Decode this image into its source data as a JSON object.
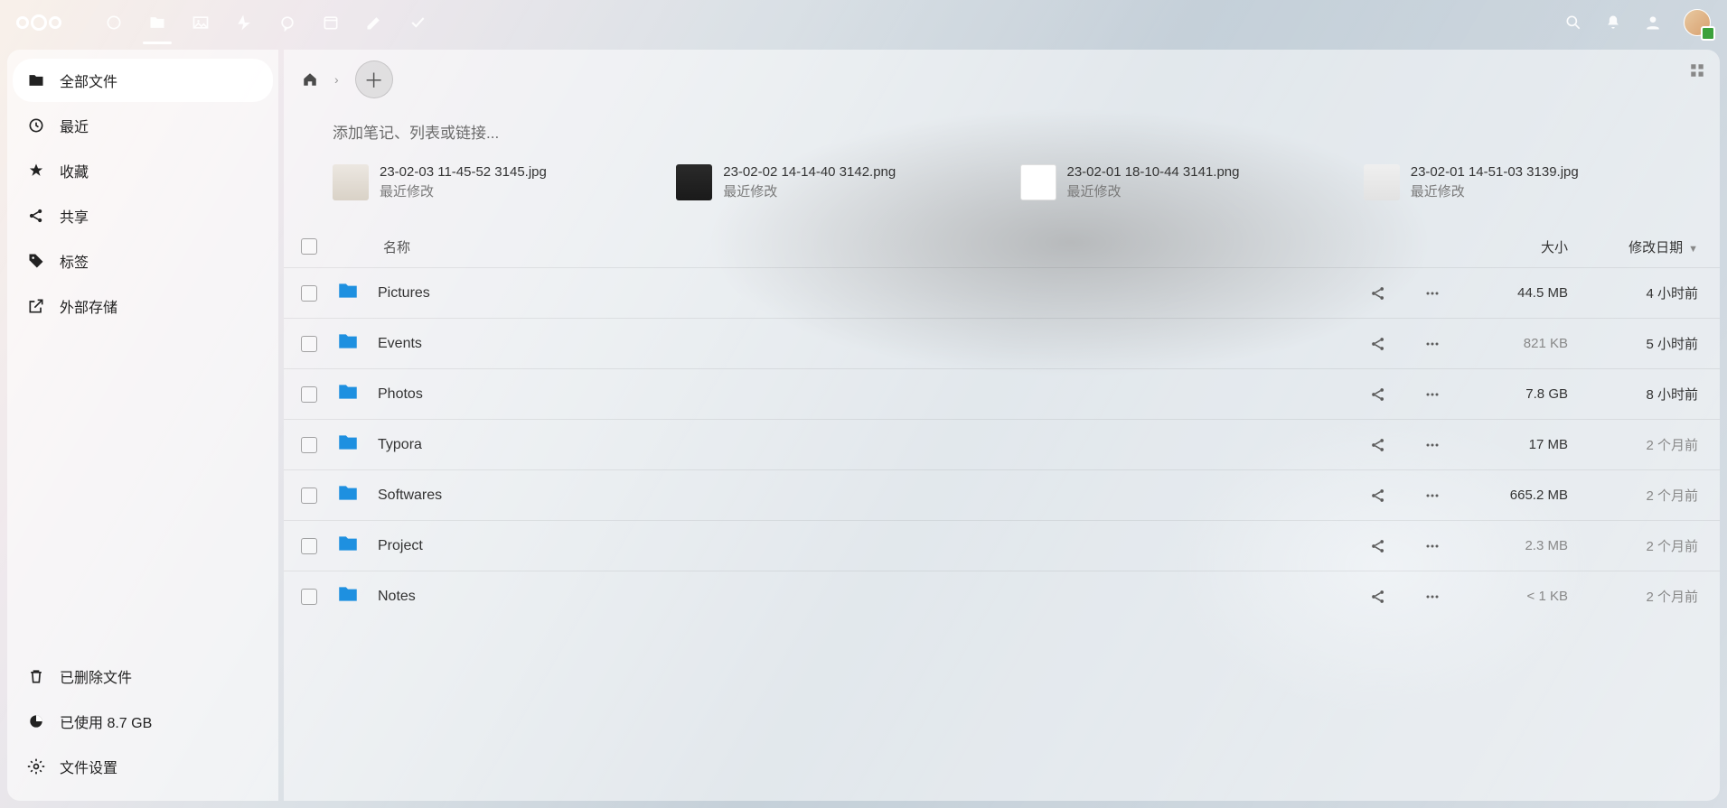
{
  "sidebar": {
    "items": [
      {
        "label": "全部文件"
      },
      {
        "label": "最近"
      },
      {
        "label": "收藏"
      },
      {
        "label": "共享"
      },
      {
        "label": "标签"
      },
      {
        "label": "外部存储"
      }
    ],
    "bottom": {
      "trash": "已删除文件",
      "quota": "已使用 8.7 GB",
      "settings": "文件设置"
    }
  },
  "notes_placeholder": "添加笔记、列表或链接...",
  "recent_label": "最近修改",
  "recent": [
    {
      "name": "23-02-03 11-45-52 3145.jpg"
    },
    {
      "name": "23-02-02 14-14-40 3142.png"
    },
    {
      "name": "23-02-01 18-10-44 3141.png"
    },
    {
      "name": "23-02-01 14-51-03 3139.jpg"
    }
  ],
  "columns": {
    "name": "名称",
    "size": "大小",
    "modified": "修改日期"
  },
  "files": [
    {
      "name": "Pictures",
      "size": "44.5 MB",
      "date": "4 小时前",
      "size_faded": false,
      "date_faded": false
    },
    {
      "name": "Events",
      "size": "821 KB",
      "date": "5 小时前",
      "size_faded": true,
      "date_faded": false
    },
    {
      "name": "Photos",
      "size": "7.8 GB",
      "date": "8 小时前",
      "size_faded": false,
      "date_faded": false
    },
    {
      "name": "Typora",
      "size": "17 MB",
      "date": "2 个月前",
      "size_faded": false,
      "date_faded": true
    },
    {
      "name": "Softwares",
      "size": "665.2 MB",
      "date": "2 个月前",
      "size_faded": false,
      "date_faded": true
    },
    {
      "name": "Project",
      "size": "2.3 MB",
      "date": "2 个月前",
      "size_faded": true,
      "date_faded": true
    },
    {
      "name": "Notes",
      "size": "< 1 KB",
      "date": "2 个月前",
      "size_faded": true,
      "date_faded": true
    }
  ]
}
